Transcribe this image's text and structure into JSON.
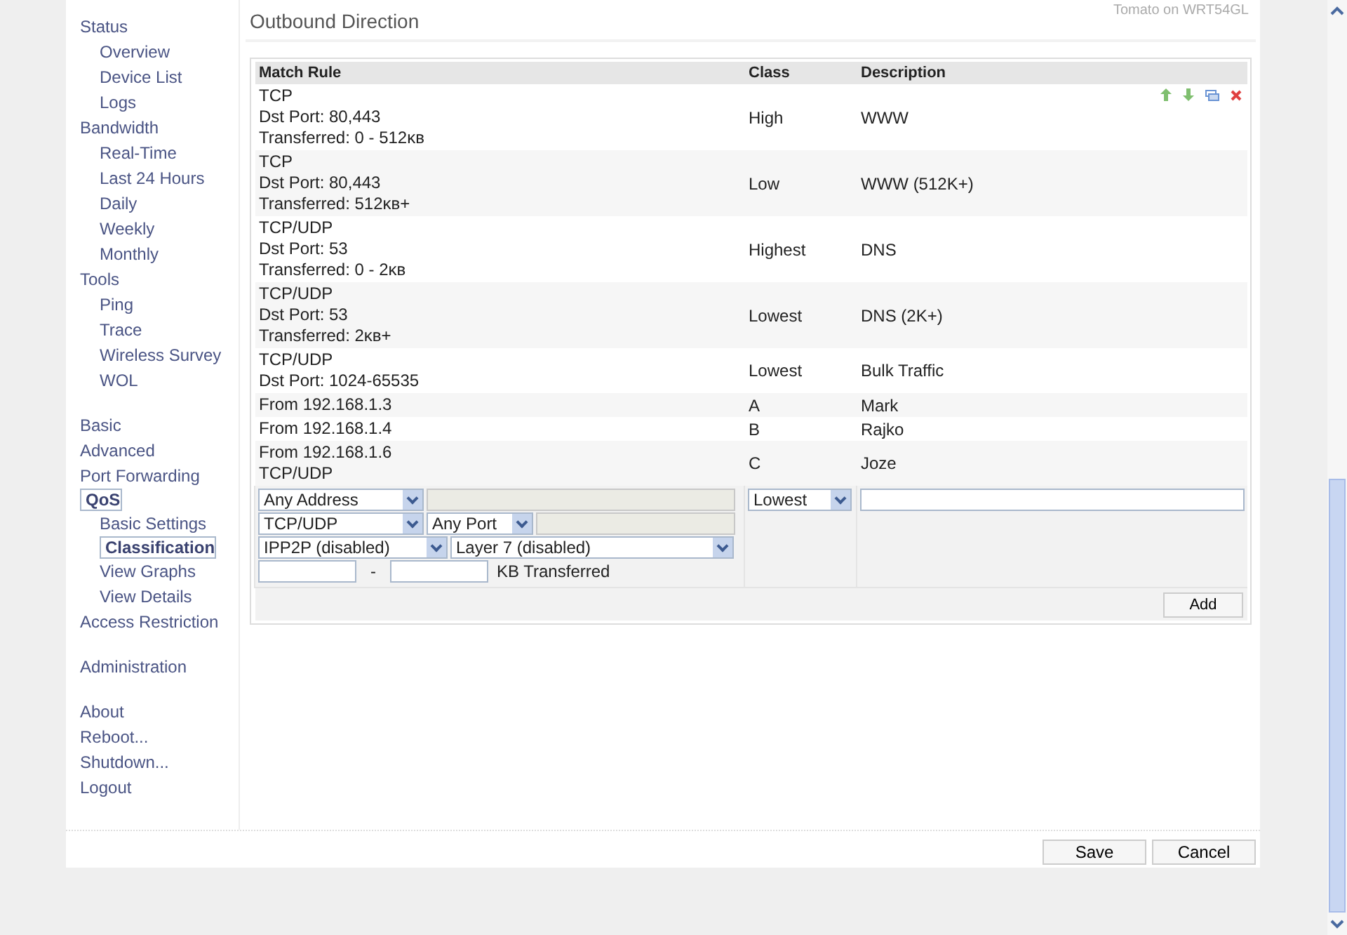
{
  "header": {
    "router_name": "Tomato on WRT54GL"
  },
  "sidebar": {
    "groups": [
      [
        {
          "label": "Status",
          "selected": false,
          "children": [
            {
              "label": "Overview",
              "selected": false
            },
            {
              "label": "Device List",
              "selected": false
            },
            {
              "label": "Logs",
              "selected": false
            }
          ]
        },
        {
          "label": "Bandwidth",
          "selected": false,
          "children": [
            {
              "label": "Real-Time",
              "selected": false
            },
            {
              "label": "Last 24 Hours",
              "selected": false
            },
            {
              "label": "Daily",
              "selected": false
            },
            {
              "label": "Weekly",
              "selected": false
            },
            {
              "label": "Monthly",
              "selected": false
            }
          ]
        },
        {
          "label": "Tools",
          "selected": false,
          "children": [
            {
              "label": "Ping",
              "selected": false
            },
            {
              "label": "Trace",
              "selected": false
            },
            {
              "label": "Wireless Survey",
              "selected": false
            },
            {
              "label": "WOL",
              "selected": false
            }
          ]
        }
      ],
      [
        {
          "label": "Basic",
          "selected": false
        },
        {
          "label": "Advanced",
          "selected": false
        },
        {
          "label": "Port Forwarding",
          "selected": false
        },
        {
          "label": "QoS",
          "selected": true,
          "children": [
            {
              "label": "Basic Settings",
              "selected": false
            },
            {
              "label": "Classification",
              "selected": true
            },
            {
              "label": "View Graphs",
              "selected": false
            },
            {
              "label": "View Details",
              "selected": false
            }
          ]
        },
        {
          "label": "Access Restriction",
          "selected": false
        }
      ],
      [
        {
          "label": "Administration",
          "selected": false
        }
      ],
      [
        {
          "label": "About",
          "selected": false
        },
        {
          "label": "Reboot...",
          "selected": false
        },
        {
          "label": "Shutdown...",
          "selected": false
        },
        {
          "label": "Logout",
          "selected": false
        }
      ]
    ]
  },
  "section_title": "Outbound Direction",
  "table": {
    "columns": [
      "Match Rule",
      "Class",
      "Description"
    ],
    "rows": [
      {
        "match": [
          "TCP",
          "Dst Port: 80,443",
          "Transferred: 0 - 512ᴋʙ"
        ],
        "class": "High",
        "description": "WWW",
        "show_actions": true
      },
      {
        "match": [
          "TCP",
          "Dst Port: 80,443",
          "Transferred: 512ᴋʙ+"
        ],
        "class": "Low",
        "description": "WWW (512K+)",
        "show_actions": false
      },
      {
        "match": [
          "TCP/UDP",
          "Dst Port: 53",
          "Transferred: 0 - 2ᴋʙ"
        ],
        "class": "Highest",
        "description": "DNS",
        "show_actions": false
      },
      {
        "match": [
          "TCP/UDP",
          "Dst Port: 53",
          "Transferred: 2ᴋʙ+"
        ],
        "class": "Lowest",
        "description": "DNS (2K+)",
        "show_actions": false
      },
      {
        "match": [
          "TCP/UDP",
          "Dst Port: 1024-65535"
        ],
        "class": "Lowest",
        "description": "Bulk Traffic",
        "show_actions": false
      },
      {
        "match": [
          "From 192.168.1.3"
        ],
        "class": "A",
        "description": "Mark",
        "show_actions": false
      },
      {
        "match": [
          "From 192.168.1.4"
        ],
        "class": "B",
        "description": "Rajko",
        "show_actions": false
      },
      {
        "match": [
          "From 192.168.1.6",
          "TCP/UDP"
        ],
        "class": "C",
        "description": "Joze",
        "show_actions": false
      }
    ]
  },
  "new_rule": {
    "address_type": "Any Address",
    "protocol": "TCP/UDP",
    "port_type": "Any Port",
    "ipp2p": "IPP2P (disabled)",
    "layer7": "Layer 7 (disabled)",
    "range_separator": "-",
    "transferred_label": "KB Transferred",
    "class": "Lowest",
    "add_button": "Add"
  },
  "footer": {
    "buttons": [
      "Save",
      "Cancel"
    ]
  }
}
